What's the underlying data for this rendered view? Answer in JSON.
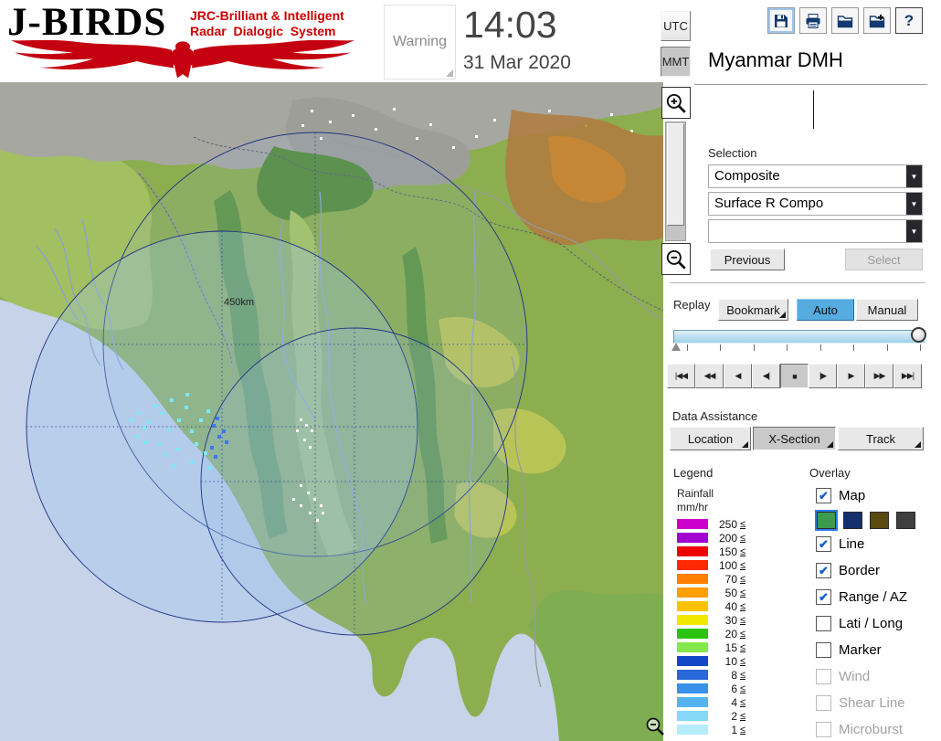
{
  "header": {
    "logo": {
      "title": "J-BIRDS",
      "subtitle1": "JRC-Brilliant & Intelligent",
      "subtitle2": "Radar  Dialogic  System"
    },
    "warning_label": "Warning",
    "time": "14:03",
    "date": "31 Mar 2020",
    "utc_label": "UTC",
    "mmt_label": "MMT",
    "station_name": "Myanmar DMH",
    "toolbar": {
      "help_glyph": "?",
      "buttons": [
        "save",
        "print",
        "open",
        "export",
        "help"
      ]
    }
  },
  "map": {
    "range_label": "450km"
  },
  "selection": {
    "label": "Selection",
    "combo1": "Composite",
    "combo2": "Surface R Compo",
    "combo3": "",
    "previous_label": "Previous",
    "select_label": "Select"
  },
  "replay": {
    "label": "Replay",
    "bookmark_label": "Bookmark",
    "auto_label": "Auto",
    "manual_label": "Manual",
    "playback": [
      {
        "name": "skip-to-start",
        "glyph": "|◀◀"
      },
      {
        "name": "fast-rewind",
        "glyph": "◀◀"
      },
      {
        "name": "play-backward",
        "glyph": "◀"
      },
      {
        "name": "step-backward",
        "glyph": "◀|"
      },
      {
        "name": "stop",
        "glyph": "■",
        "pressed": true
      },
      {
        "name": "step-forward",
        "glyph": "|▶"
      },
      {
        "name": "play",
        "glyph": "▶"
      },
      {
        "name": "fast-forward",
        "glyph": "▶▶"
      },
      {
        "name": "skip-to-end",
        "glyph": "▶▶|"
      }
    ]
  },
  "data_assistance": {
    "label": "Data Assistance",
    "location_label": "Location",
    "xsection_label": "X-Section",
    "track_label": "Track"
  },
  "legend": {
    "label": "Legend",
    "unit1": "Rainfall",
    "unit2": "mm/hr",
    "suffix": "≤",
    "scale": [
      {
        "value": "250",
        "color": "#cc00cc"
      },
      {
        "value": "200",
        "color": "#a000d0"
      },
      {
        "value": "150",
        "color": "#ee0000"
      },
      {
        "value": "100",
        "color": "#ff2800"
      },
      {
        "value": "70",
        "color": "#ff8000"
      },
      {
        "value": "50",
        "color": "#ffa000"
      },
      {
        "value": "40",
        "color": "#ffc000"
      },
      {
        "value": "30",
        "color": "#f0e800"
      },
      {
        "value": "20",
        "color": "#2cc410"
      },
      {
        "value": "15",
        "color": "#84e84c"
      },
      {
        "value": "10",
        "color": "#1048c8"
      },
      {
        "value": "8",
        "color": "#2868d8"
      },
      {
        "value": "6",
        "color": "#3890e8"
      },
      {
        "value": "4",
        "color": "#55b4f0"
      },
      {
        "value": "2",
        "color": "#86d8f8"
      },
      {
        "value": "1",
        "color": "#b4ecfc"
      }
    ]
  },
  "overlay": {
    "label": "Overlay",
    "map_styles": [
      {
        "color": "#3d9a50",
        "selected": true
      },
      {
        "color": "#16306e",
        "selected": false
      },
      {
        "color": "#5a4a10",
        "selected": false
      },
      {
        "color": "#3f3f3f",
        "selected": false
      }
    ],
    "items": [
      {
        "label": "Map",
        "checked": true,
        "enabled": true
      },
      {
        "label": "Line",
        "checked": true,
        "enabled": true
      },
      {
        "label": "Border",
        "checked": true,
        "enabled": true
      },
      {
        "label": "Range / AZ",
        "checked": true,
        "enabled": true
      },
      {
        "label": "Lati / Long",
        "checked": false,
        "enabled": true
      },
      {
        "label": "Marker",
        "checked": false,
        "enabled": true
      },
      {
        "label": "Wind",
        "checked": false,
        "enabled": false
      },
      {
        "label": "Shear Line",
        "checked": false,
        "enabled": false
      },
      {
        "label": "Microburst",
        "checked": false,
        "enabled": false
      }
    ]
  }
}
